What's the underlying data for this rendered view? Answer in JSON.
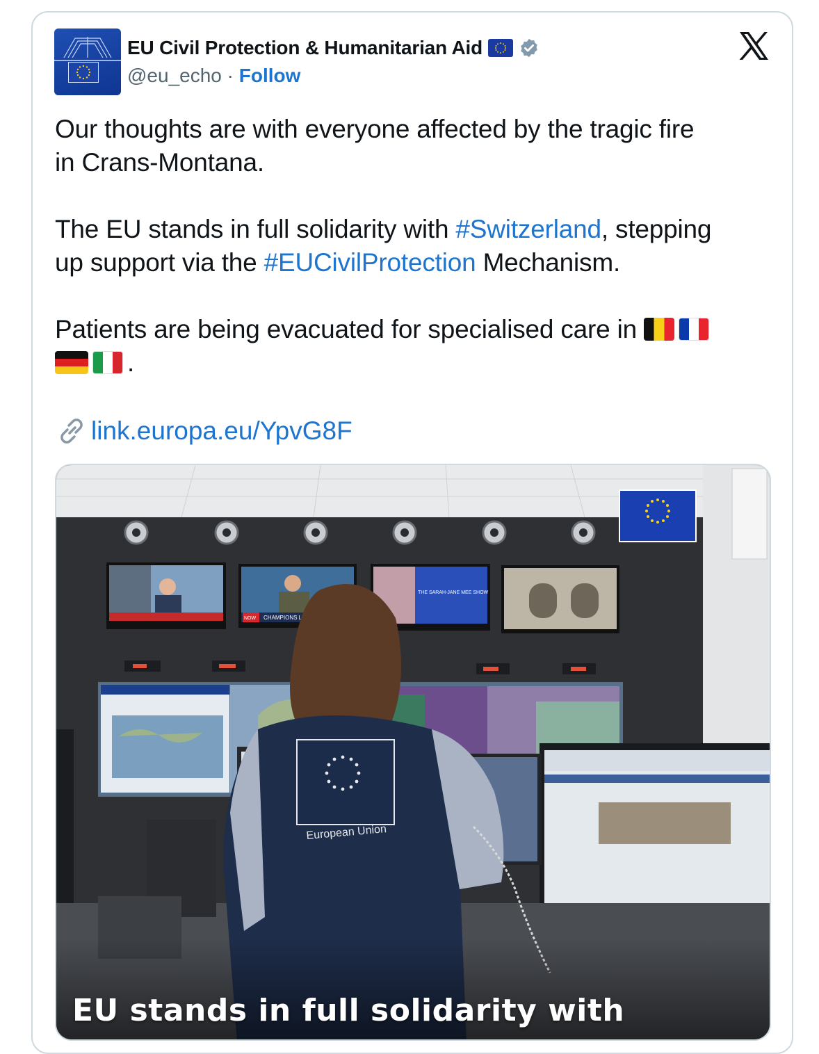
{
  "account": {
    "name": "EU Civil Protection & Humanitarian Aid",
    "handle": "@eu_echo",
    "separator": "·",
    "follow_label": "Follow"
  },
  "icons": {
    "platform": "x-logo-icon",
    "verified": "verified-badge-icon",
    "name_emoji": "eu-flag-emoji",
    "link": "link-icon"
  },
  "tweet": {
    "para1_line1": "Our thoughts are with everyone affected by the tragic fire",
    "para1_line2": "in Crans-Montana.",
    "para2_line1_pre": "The EU stands in full solidarity with ",
    "para2_line1_tag": "#Switzerland",
    "para2_line1_post": ", stepping",
    "para2_line2_pre": "up support via the ",
    "para2_line2_tag": "#EUCivilProtection",
    "para2_line2_post": " Mechanism.",
    "para3_line1": "Patients are being evacuated for specialised care in",
    "para3_flags_line1": [
      "belgium-flag",
      "france-flag"
    ],
    "para3_flags_line2": [
      "germany-flag",
      "italy-flag"
    ],
    "para3_end": ".",
    "link": "link.europa.eu/YpvG8F"
  },
  "media": {
    "caption": "EU stands in full solidarity with",
    "vest_text": "European Union",
    "tv_banner": "CHAMPIONS LEAGUE",
    "tv_show": "THE SARAH-JANE MEE SHOW",
    "tv_now": "NOW"
  },
  "colors": {
    "link_blue": "#1d75d0",
    "eu_blue": "#1a3aa0",
    "eu_gold": "#f7d117",
    "verified_grey": "#829aab"
  }
}
